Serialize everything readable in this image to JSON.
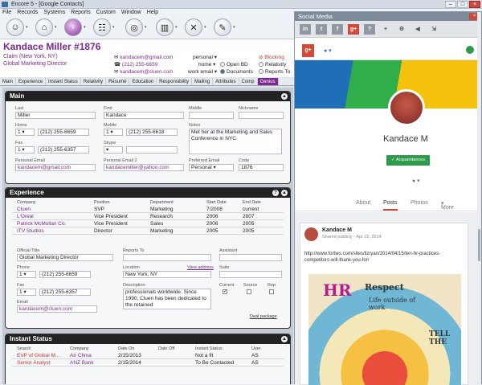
{
  "window": {
    "title": "Encore 5 - [Google Contacts]"
  },
  "menu": [
    "File",
    "Records",
    "Systems",
    "Reports",
    "Custom",
    "Window",
    "Help"
  ],
  "record": {
    "name": "Kandace Miller  #1876",
    "location": "Claim (New York, NY)",
    "title": "Global Marketing Director",
    "emails": [
      "kandacem@gmail.com",
      "(212) 255-6659",
      "kandacem@cluen.com"
    ],
    "email_types": [
      "personal",
      "home",
      "work email"
    ],
    "options": [
      "Open BD",
      "Documents"
    ],
    "flags": [
      "Blocking",
      "Relativity",
      "Reports To"
    ]
  },
  "tabs": [
    "Main",
    "Experience",
    "Instant Status",
    "Relativity",
    "Résumé",
    "Education",
    "Responsibility",
    "Mailing",
    "Attributes",
    "Comp",
    "Genius"
  ],
  "main": {
    "title": "Main",
    "labels": {
      "last": "Last",
      "first": "First",
      "middle": "Middle",
      "nickname": "Nickname",
      "home": "Home",
      "mobile": "Mobile",
      "notes": "Notes",
      "fax": "Fax",
      "skype": "Skype",
      "personal_email": "Personal Email",
      "personal_email2": "Personal Email 2",
      "preferred_email": "Preferred Email",
      "code": "Code"
    },
    "last": "Miller",
    "first": "Kandace",
    "middle": "",
    "nickname": "",
    "home_num": "1",
    "home": "(212) 255-6659",
    "mobile_num": "1",
    "mobile": "(212) 255-6618",
    "notes": "Met her at the Marketing and Sales Conference in NYC.",
    "fax_num": "1",
    "fax": "(212) 255-6357",
    "personal_email": "kandacem@gmail.com",
    "personal_email2": "kandacemiller@yahoo.com",
    "preferred_email": "Personal",
    "code": "1876"
  },
  "experience": {
    "title": "Experience",
    "headers": [
      "Company",
      "Position",
      "Department",
      "Start Date",
      "End Date"
    ],
    "rows": [
      {
        "company": "Cluen",
        "position": "SVP",
        "department": "Marketing",
        "start": "7/2008",
        "end": "current"
      },
      {
        "company": "L'Oreal",
        "position": "Vice President",
        "department": "Research",
        "start": "2006",
        "end": "2007"
      },
      {
        "company": "Patrick McMullan Co.",
        "position": "Vice President",
        "department": "Sales",
        "start": "2006",
        "end": "2005"
      },
      {
        "company": "ITV Studios",
        "position": "Director",
        "department": "Marketing",
        "start": "2005",
        "end": "2005"
      }
    ],
    "labels": {
      "official_title": "Official Title",
      "reports_to": "Reports To",
      "assistant": "Assistant",
      "phone": "Phone",
      "location": "Location",
      "view_address": "View address",
      "suite": "Suite",
      "fax": "Fax",
      "description": "Description",
      "current": "Current",
      "source": "Source",
      "rep": "Rep",
      "email": "Email",
      "deal_package": "Deal package"
    },
    "official_title": "Global Marketing Director",
    "phone_num": "1",
    "phone": "(212) 255-6659",
    "location": "New York, NY",
    "fax_num": "1",
    "fax": "(212) 255-6357",
    "description": "professionals worldwide. Since 1990, Cluen has been dedicated to the retained",
    "email": "kandacem@cluen.com"
  },
  "instant_status": {
    "title": "Instant Status",
    "headers": [
      "Search",
      "Company",
      "Date On",
      "Date Off",
      "Instant Status",
      "User"
    ],
    "rows": [
      {
        "search": "EVP of Global M...",
        "company": "Air China",
        "date_on": "2/15/2013",
        "date_off": "",
        "status": "Not a fit",
        "user": "AS"
      },
      {
        "search": "Senior Analyst",
        "company": "ANZ Bank",
        "date_on": "2/15/2014",
        "date_off": "",
        "status": "To Be Contacted",
        "user": "AS"
      }
    ]
  },
  "social": {
    "title": "Social Media",
    "icons": [
      "in",
      "t",
      "f",
      "g+",
      "?",
      "+",
      "gear",
      "back"
    ],
    "profile_name": "Kandace M",
    "acq_label": "Acquaintances",
    "profile_tabs": [
      "About",
      "Posts",
      "Photos",
      "More"
    ],
    "post_author": "Kandace M",
    "post_meta": "Shared publicly  -  Apr 15, 2014",
    "post_link": "http://www.forbes.com/sites/lizryan/2014/04/15/ten-hr-practices-competitors-will-thank-you-for/",
    "art_words": [
      "HR",
      "Respect",
      "Life outside of work",
      "TELL THE"
    ],
    "brand_color": "#7b2a8f"
  }
}
